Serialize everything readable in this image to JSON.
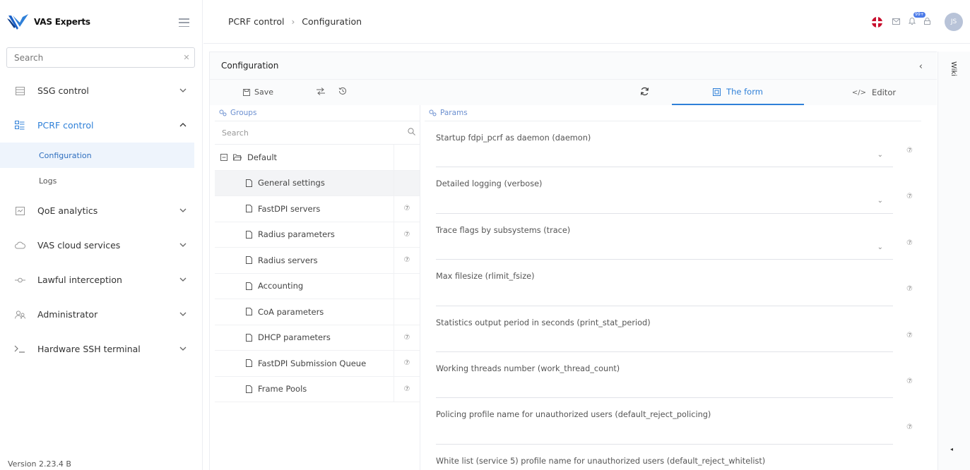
{
  "brand": {
    "name": "VAS Experts",
    "accent": "#2f80d8"
  },
  "sidebar": {
    "search_placeholder": "Search",
    "items": [
      {
        "label": "SSG control",
        "icon": "server-icon"
      },
      {
        "label": "PCRF control",
        "icon": "pcrf-icon",
        "expanded": true
      },
      {
        "label": "QoE analytics",
        "icon": "chart-icon"
      },
      {
        "label": "VAS cloud services",
        "icon": "cloud-icon"
      },
      {
        "label": "Lawful interception",
        "icon": "interception-icon"
      },
      {
        "label": "Administrator",
        "icon": "users-icon"
      },
      {
        "label": "Hardware SSH terminal",
        "icon": "terminal-icon"
      }
    ],
    "sub_items": [
      "Configuration",
      "Logs"
    ],
    "version": "Version 2.23.4 B"
  },
  "header": {
    "breadcrumb": [
      "PCRF control",
      "Configuration"
    ],
    "badge": "99+",
    "avatar": "JS"
  },
  "panel": {
    "title": "Configuration",
    "save_label": "Save",
    "tabs": [
      "The form",
      "Editor"
    ],
    "groups_label": "Groups",
    "params_label": "Params",
    "groups_search_placeholder": "Search",
    "root_group": "Default",
    "groups": [
      {
        "label": "General settings",
        "help": false,
        "selected": true
      },
      {
        "label": "FastDPI servers",
        "help": true
      },
      {
        "label": "Radius parameters",
        "help": true
      },
      {
        "label": "Radius servers",
        "help": true
      },
      {
        "label": "Accounting",
        "help": false
      },
      {
        "label": "CoA parameters",
        "help": false
      },
      {
        "label": "DHCP parameters",
        "help": true
      },
      {
        "label": "FastDPI Submission Queue",
        "help": true
      },
      {
        "label": "Frame Pools",
        "help": true
      }
    ],
    "params": [
      {
        "label": "Startup fdpi_pcrf as daemon (daemon)",
        "dropdown": true
      },
      {
        "label": "Detailed logging (verbose)",
        "dropdown": true
      },
      {
        "label": "Trace flags by subsystems (trace)",
        "dropdown": true
      },
      {
        "label": "Max filesize (rlimit_fsize)",
        "dropdown": false
      },
      {
        "label": "Statistics output period in seconds (print_stat_period)",
        "dropdown": false
      },
      {
        "label": "Working threads number (work_thread_count)",
        "dropdown": false
      },
      {
        "label": "Policing profile name for unauthorized users (default_reject_policing)",
        "dropdown": false
      },
      {
        "label": "White list (service 5) profile name for unauthorized users (default_reject_whitelist)",
        "dropdown": false
      }
    ]
  },
  "wiki": {
    "label": "Wiki"
  }
}
